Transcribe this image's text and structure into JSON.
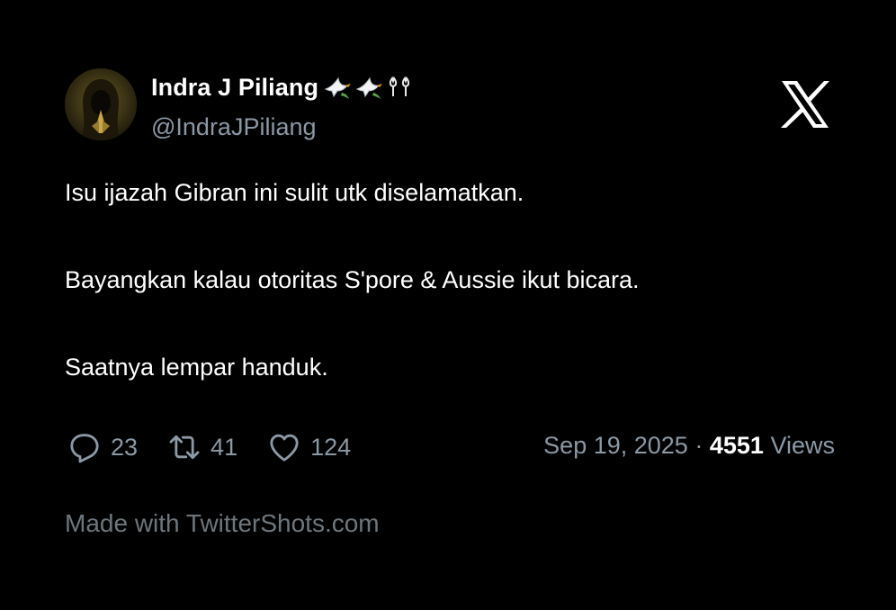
{
  "author": {
    "display_name": "Indra J Piliang",
    "handle": "@IndraJPiliang",
    "name_emojis": [
      "dove-icon",
      "dove-icon",
      "tulip-icon"
    ]
  },
  "tweet": {
    "lines": [
      "Isu ijazah Gibran ini sulit utk diselamatkan.",
      "Bayangkan kalau otoritas S'pore & Aussie ikut bicara.",
      "Saatnya lempar handuk."
    ]
  },
  "stats": {
    "replies": "23",
    "retweets": "41",
    "likes": "124"
  },
  "meta": {
    "date": "Sep 19, 2025",
    "separator": "·",
    "views_count": "4551",
    "views_label": "Views"
  },
  "footer": {
    "text": "Made with TwitterShots.com"
  },
  "colors": {
    "background": "#000000",
    "text_primary": "#ffffff",
    "text_secondary": "#8b98a5",
    "footer_text": "#6e767d"
  }
}
